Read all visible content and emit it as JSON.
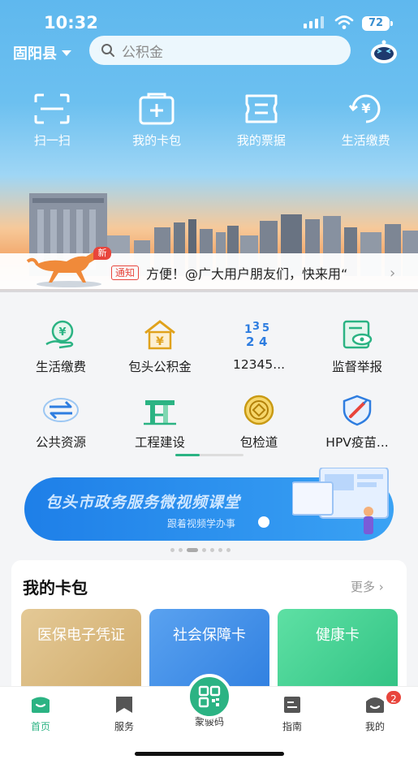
{
  "status": {
    "time": "10:32",
    "battery": "72"
  },
  "header": {
    "city": "固阳县",
    "search_placeholder": "公积金"
  },
  "quick_actions": [
    {
      "label": "扫一扫",
      "icon": "scan-icon"
    },
    {
      "label": "我的卡包",
      "icon": "card-wallet-icon"
    },
    {
      "label": "我的票据",
      "icon": "receipt-icon"
    },
    {
      "label": "生活缴费",
      "icon": "yuan-payment-icon"
    }
  ],
  "notice": {
    "new_badge": "新",
    "tag": "通知",
    "text": "方便！@广大用户朋友们，快来用“"
  },
  "services": [
    {
      "label": "生活缴费",
      "icon": "payment-hand-icon"
    },
    {
      "label": "包头公积金",
      "icon": "house-yuan-icon"
    },
    {
      "label": "12345...",
      "icon": "hotline-12345-icon"
    },
    {
      "label": "监督举报",
      "icon": "report-eye-icon"
    },
    {
      "label": "公共资源",
      "icon": "exchange-arrows-icon"
    },
    {
      "label": "工程建设",
      "icon": "construction-icon"
    },
    {
      "label": "包检道",
      "icon": "procuratorate-icon"
    },
    {
      "label": "HPV疫苗...",
      "icon": "vaccine-shield-icon"
    }
  ],
  "video_banner": {
    "title": "包头市政务服务微视频课堂",
    "subtitle": "跟着视频学办事"
  },
  "wallet": {
    "title": "我的卡包",
    "more": "更多",
    "cards": [
      {
        "label": "医保电子凭证",
        "color": "#d6b47a"
      },
      {
        "label": "社会保障卡",
        "color": "#3d8de8"
      },
      {
        "label": "健康卡",
        "color": "#3fcf8e"
      }
    ]
  },
  "tabbar": {
    "items": [
      {
        "label": "首页",
        "icon": "home-icon"
      },
      {
        "label": "服务",
        "icon": "bookmark-icon"
      },
      {
        "label": "蒙骏码",
        "icon": "qr-code-icon"
      },
      {
        "label": "指南",
        "icon": "guide-doc-icon"
      },
      {
        "label": "我的",
        "icon": "profile-icon"
      }
    ],
    "badge": "2"
  },
  "colors": {
    "accent": "#2bb383",
    "alert": "#e8453c",
    "sky": "#5fb8ee"
  }
}
